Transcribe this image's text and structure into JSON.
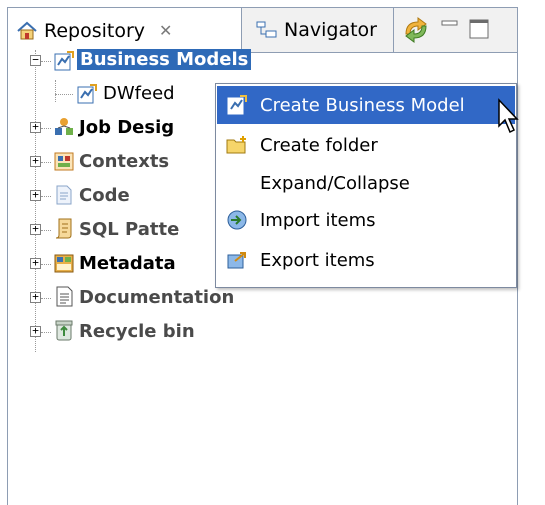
{
  "tabs": {
    "repository": {
      "label": "Repository",
      "close": "✕"
    },
    "navigator": {
      "label": "Navigator"
    }
  },
  "tree": {
    "business_models": "Business Models",
    "dwfeed": "DWfeed",
    "job_designs": "Job Desig",
    "contexts": "Contexts",
    "code": "Code",
    "sql_patterns": "SQL Patte",
    "metadata": "Metadata",
    "documentation": "Documentation",
    "recycle_bin": "Recycle bin"
  },
  "menu": {
    "create_business_model": "Create Business Model",
    "create_folder": "Create folder",
    "expand_collapse": "Expand/Collapse",
    "import_items": "Import items",
    "export_items": "Export items"
  },
  "colors": {
    "selection": "#2e6ab7",
    "menu_highlight": "#3168c6",
    "border": "#8e9db3"
  }
}
